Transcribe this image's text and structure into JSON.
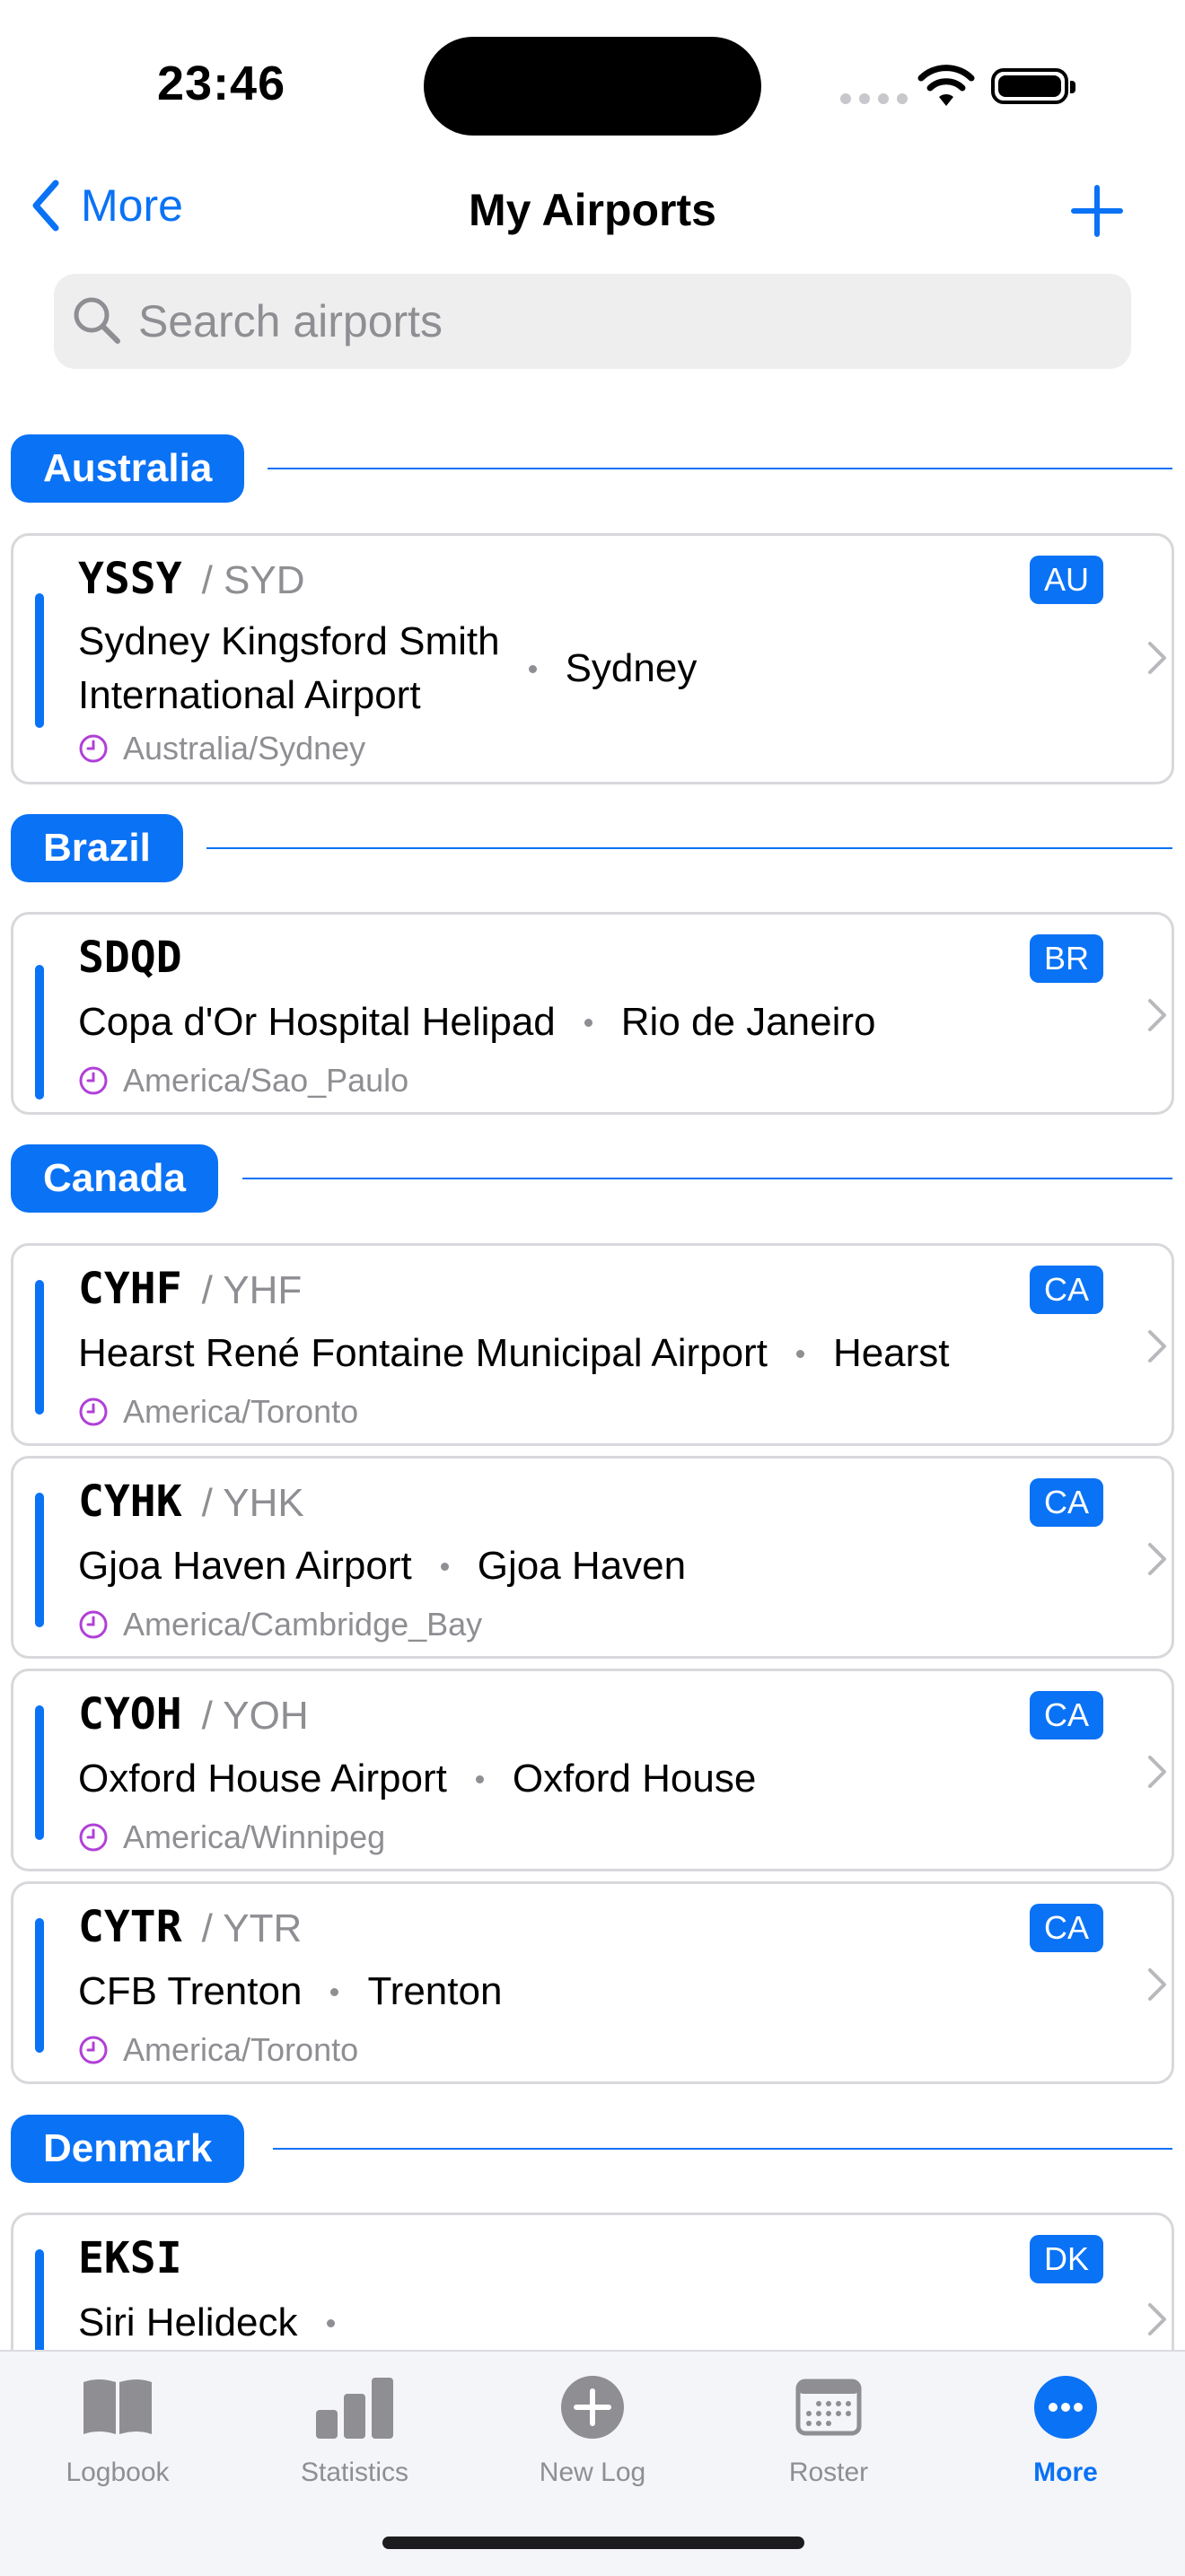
{
  "status_bar": {
    "time": "23:46"
  },
  "nav": {
    "back_label": "More",
    "title": "My Airports"
  },
  "search": {
    "placeholder": "Search airports",
    "value": ""
  },
  "sections": [
    {
      "country": "Australia",
      "airports": [
        {
          "icao": "YSSY",
          "iata": "/ SYD",
          "badge": "AU",
          "name_line1": "Sydney Kingsford Smith",
          "name_line2": "International Airport",
          "city": "Sydney",
          "timezone": "Australia/Sydney"
        }
      ]
    },
    {
      "country": "Brazil",
      "airports": [
        {
          "icao": "SDQD",
          "iata": "",
          "badge": "BR",
          "name": "Copa d'Or Hospital Helipad",
          "city": "Rio de Janeiro",
          "timezone": "America/Sao_Paulo"
        }
      ]
    },
    {
      "country": "Canada",
      "airports": [
        {
          "icao": "CYHF",
          "iata": "/ YHF",
          "badge": "CA",
          "name": "Hearst René Fontaine Municipal Airport",
          "city": "Hearst",
          "timezone": "America/Toronto"
        },
        {
          "icao": "CYHK",
          "iata": "/ YHK",
          "badge": "CA",
          "name": "Gjoa Haven Airport",
          "city": "Gjoa Haven",
          "timezone": "America/Cambridge_Bay"
        },
        {
          "icao": "CYOH",
          "iata": "/ YOH",
          "badge": "CA",
          "name": "Oxford House Airport",
          "city": "Oxford House",
          "timezone": "America/Winnipeg"
        },
        {
          "icao": "CYTR",
          "iata": "/ YTR",
          "badge": "CA",
          "name": "CFB Trenton",
          "city": "Trenton",
          "timezone": "America/Toronto"
        }
      ]
    },
    {
      "country": "Denmark",
      "airports": [
        {
          "icao": "EKSI",
          "iata": "",
          "badge": "DK",
          "name": "Siri Helideck",
          "city": "",
          "timezone": ""
        }
      ]
    }
  ],
  "tabs": [
    {
      "label": "Logbook",
      "icon": "book-icon",
      "active": false
    },
    {
      "label": "Statistics",
      "icon": "bar-chart-icon",
      "active": false
    },
    {
      "label": "New Log",
      "icon": "plus-circle-icon",
      "active": false
    },
    {
      "label": "Roster",
      "icon": "calendar-icon",
      "active": false
    },
    {
      "label": "More",
      "icon": "ellipsis-circle-icon",
      "active": true
    }
  ],
  "colors": {
    "accent": "#0a72f5",
    "timezone_clock": "#b040d8",
    "secondary_text": "#8e8e93"
  }
}
